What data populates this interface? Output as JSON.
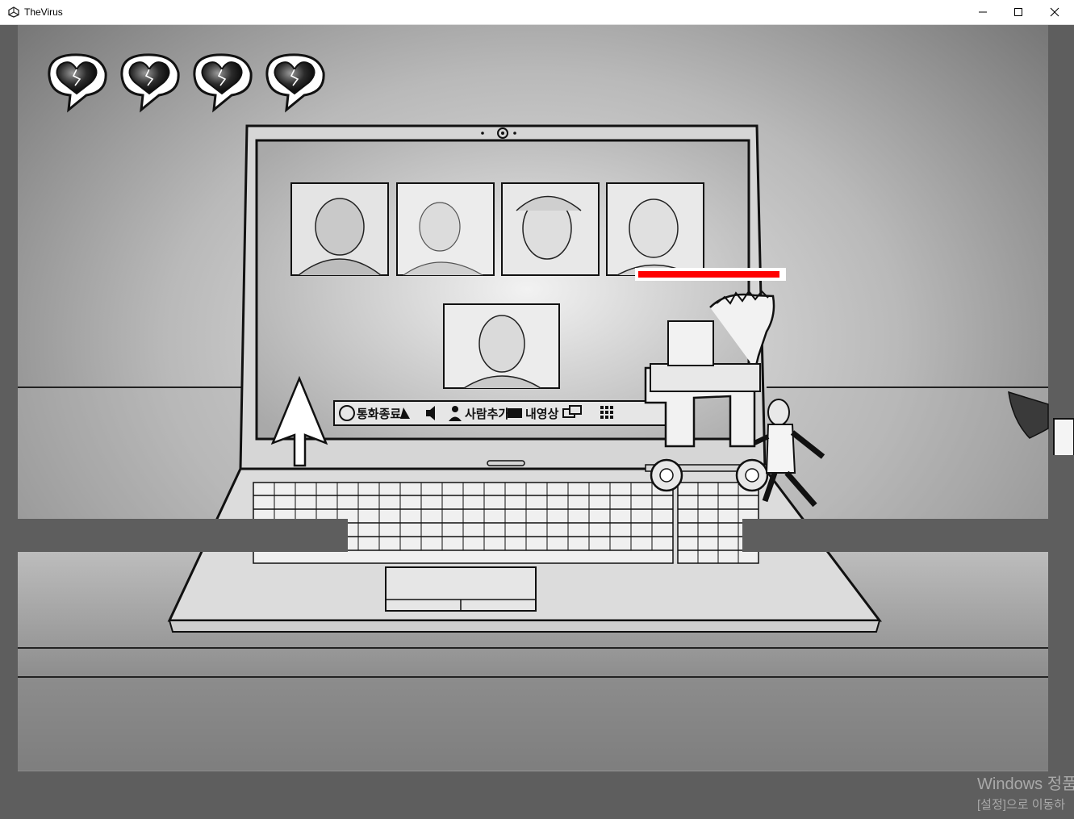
{
  "window": {
    "title": "TheVirus",
    "minimize_icon": "minimize-icon",
    "maximize_icon": "maximize-icon",
    "close_icon": "close-icon"
  },
  "hud": {
    "lives": 4,
    "life_icon": "heart-speech-bubble-icon",
    "boss_health_fraction": 0.98,
    "health_color": "#ff0000"
  },
  "laptop_screen": {
    "call_bar": {
      "end_call_label": "통화종료",
      "add_person_label": "사람추가",
      "video_label": "내영상"
    }
  },
  "watermark": {
    "line1": "Windows 정품",
    "line2": "[설정]으로 이동하"
  }
}
